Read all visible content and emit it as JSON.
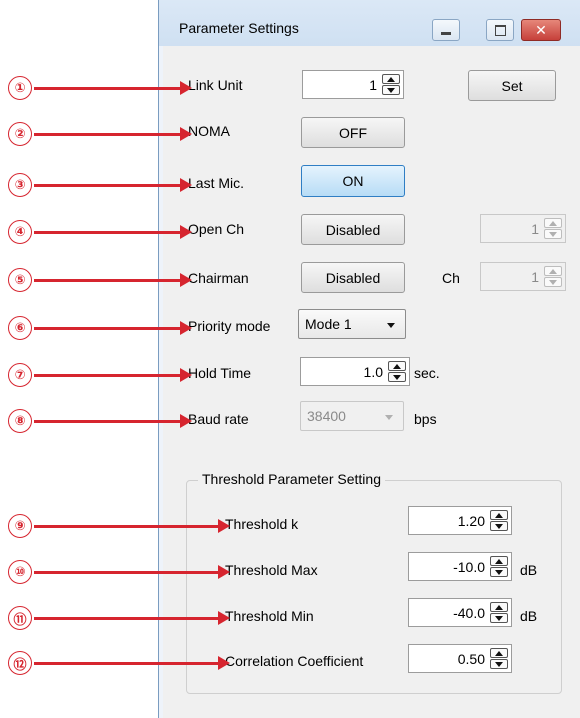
{
  "window": {
    "title": "Parameter Settings",
    "controls": [
      "minimize-icon",
      "maximize-icon",
      "close-icon"
    ],
    "accent_color": "#2f7ec4",
    "close_color": "#c6403a"
  },
  "callouts": [
    "①",
    "②",
    "③",
    "④",
    "⑤",
    "⑥",
    "⑦",
    "⑧",
    "⑨",
    "⑩",
    "⑪",
    "⑫"
  ],
  "callout_color": "#d6252f",
  "form": {
    "link_unit": {
      "label": "Link Unit",
      "value": "1"
    },
    "set_label": "Set",
    "noma": {
      "label": "NOMA",
      "value": "OFF"
    },
    "last_mic": {
      "label": "Last Mic.",
      "value": "ON"
    },
    "open_ch": {
      "label": "Open Ch",
      "value": "Disabled",
      "ch_value": "1"
    },
    "chairman": {
      "label": "Chairman",
      "value": "Disabled",
      "ch_label": "Ch",
      "ch_value": "1"
    },
    "priority_mode": {
      "label": "Priority mode",
      "value": "Mode 1"
    },
    "hold_time": {
      "label": "Hold Time",
      "value": "1.0",
      "unit": "sec."
    },
    "baud_rate": {
      "label": "Baud rate",
      "value": "38400",
      "unit": "bps"
    }
  },
  "threshold": {
    "group_title": "Threshold Parameter Setting",
    "k": {
      "label": "Threshold k",
      "value": "1.20"
    },
    "max": {
      "label": "Threshold Max",
      "value": "-10.0",
      "unit": "dB"
    },
    "min": {
      "label": "Threshold Min",
      "value": "-40.0",
      "unit": "dB"
    },
    "corr": {
      "label": "Correlation Coefficient",
      "value": "0.50"
    }
  }
}
